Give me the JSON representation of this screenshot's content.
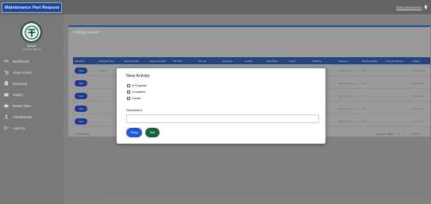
{
  "app": {
    "title": "Maintenance Part Request"
  },
  "header": {
    "user": "Mary Beaumont"
  },
  "logo": {
    "name": "Denon",
    "subtitle": "ELECTRIC SERVICE"
  },
  "sidebar": {
    "items": [
      {
        "label": "Dashboard",
        "icon": "gauge-icon"
      },
      {
        "label": "Shop Activity",
        "icon": "cart-icon"
      },
      {
        "label": "Reporting",
        "icon": "report-icon"
      },
      {
        "label": "History",
        "icon": "book-icon"
      },
      {
        "label": "Master Data",
        "icon": "folder-icon"
      },
      {
        "label": "Administrator",
        "icon": "user-icon"
      },
      {
        "label": "Log Out",
        "icon": "logout-icon"
      }
    ]
  },
  "main": {
    "card_title": "Pending request",
    "columns": [
      "Schedule",
      "Changed Parts",
      "Serial Number",
      "Student Header",
      "WO Title",
      "Part No",
      "Language",
      "Verified",
      "Rate Base",
      "Result",
      "Machine",
      "Category",
      "Repaired Base",
      "Time Remaining",
      "Status"
    ],
    "rows": [
      {
        "action": "View",
        "cells": [
          "Serial series 1",
          "25/3/26",
          "Default value",
          "Damaged",
          "Desk",
          "P1",
          "",
          "",
          "Part",
          "Standard",
          "System values",
          "Light & data",
          "Part",
          "",
          "Waiting list"
        ]
      },
      {
        "action": "View",
        "cells": [
          "Serial series 2",
          "",
          "",
          "",
          "",
          "",
          "",
          "",
          "",
          "",
          "System values",
          "Standard value",
          "Part",
          "",
          "20264022"
        ]
      },
      {
        "action": "View",
        "cells": [
          "Serial series 3",
          "",
          "",
          "",
          "",
          "",
          "",
          "",
          "",
          "",
          "System values",
          "Standard value",
          "Part",
          "",
          "20264022"
        ]
      },
      {
        "action": "View",
        "cells": [
          "Serial series 4",
          "",
          "",
          "",
          "",
          "",
          "",
          "",
          "",
          "",
          "System values",
          "Standard value",
          "Part",
          "",
          "20264022"
        ]
      },
      {
        "action": "View",
        "cells": [
          "Serial series 5",
          "",
          "",
          "",
          "",
          "",
          "",
          "",
          "",
          "",
          "Maintenance",
          "Standard value",
          "Part",
          "",
          "20264022"
        ]
      }
    ],
    "footer_left": "1 - 5 of 5 items",
    "rows_per_page_label": "Rows per page:",
    "rows_per_page_value": "5",
    "range": "1-5 of 5"
  },
  "modal": {
    "title": "New Activity",
    "options": [
      "In Progress",
      "Completed",
      "Cancel"
    ],
    "description_label": "Description",
    "description_value": "",
    "description_placeholder": "",
    "setup_button": "Setup",
    "add_button": "Add"
  },
  "colors": {
    "brand": "#1a4aa8",
    "table_header": "#284a86",
    "setup": "#1f57d6",
    "add": "#14633b"
  }
}
